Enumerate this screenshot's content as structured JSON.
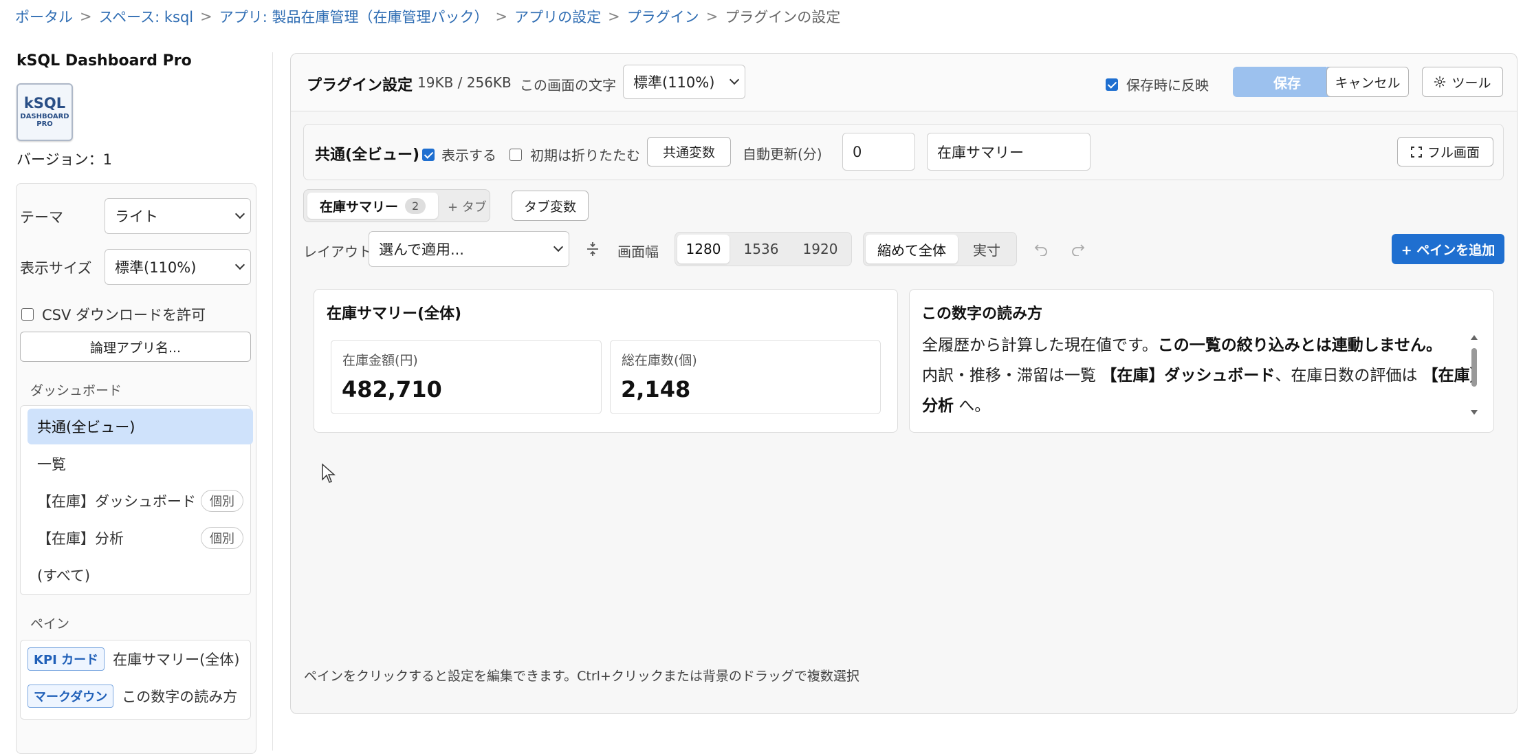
{
  "breadcrumb": {
    "portal": "ポータル",
    "space": "スペース: ksql",
    "app": "アプリ: 製品在庫管理（在庫管理パック）",
    "app_settings": "アプリの設定",
    "plugin": "プラグイン",
    "current": "プラグインの設定",
    "separator": ">"
  },
  "sidebar": {
    "app_name": "kSQL Dashboard Pro",
    "logo": {
      "line1": "kSQL",
      "line2": "DASHBOARD",
      "line3": "PRO"
    },
    "version": "バージョン：1",
    "theme_label": "テーマ",
    "theme_value": "ライト",
    "size_label": "表示サイズ",
    "size_value": "標準(110%)",
    "csv_label": "CSV ダウンロードを許可",
    "csv_checked": false,
    "logical_app_button": "論理アプリ名...",
    "dashboard_section": "ダッシュボード",
    "dashboards": [
      {
        "label": "共通(全ビュー)",
        "badge": "",
        "active": true
      },
      {
        "label": "一覧",
        "badge": "",
        "active": false
      },
      {
        "label": "【在庫】ダッシュボード",
        "badge": "個別",
        "active": false
      },
      {
        "label": "【在庫】分析",
        "badge": "個別",
        "active": false
      },
      {
        "label": "(すべて)",
        "badge": "",
        "active": false
      }
    ],
    "pane_section": "ペイン",
    "panes": [
      {
        "tag": "KPI カード",
        "label": "在庫サマリー(全体)"
      },
      {
        "tag": "マークダウン",
        "label": "この数字の読み方"
      }
    ]
  },
  "topbar": {
    "title": "プラグイン設定",
    "size_info": "19KB / 256KB",
    "font_label": "この画面の文字",
    "font_value": "標準(110%)",
    "apply_on_save_label": "保存時に反映",
    "apply_on_save_checked": true,
    "save_label": "保存",
    "cancel_label": "キャンセル",
    "tools_label": "ツール"
  },
  "common": {
    "title": "共通(全ビュー)",
    "show_label": "表示する",
    "show_checked": true,
    "collapse_label": "初期は折りたたむ",
    "collapse_checked": false,
    "vars_button": "共通変数",
    "refresh_label": "自動更新(分)",
    "refresh_value": "0",
    "name_value": "在庫サマリー",
    "fullscreen_label": "フル画面"
  },
  "tabs": {
    "active_label": "在庫サマリー",
    "active_count": "2",
    "add_tab": "+ タブ",
    "tab_vars_button": "タブ変数"
  },
  "layout": {
    "label": "レイアウト",
    "select_value": "選んで適用...",
    "width_label": "画面幅",
    "widths": [
      "1280",
      "1536",
      "1920"
    ],
    "active_width": "1280",
    "fit_label": "縮めて全体",
    "actual_label": "実寸",
    "add_pane": "+ ペインを追加"
  },
  "canvas": {
    "kpi_pane": {
      "title": "在庫サマリー(全体)",
      "cards": [
        {
          "label": "在庫金額(円)",
          "value": "482,710"
        },
        {
          "label": "総在庫数(個)",
          "value": "2,148"
        }
      ]
    },
    "md_pane": {
      "title": "この数字の読み方",
      "line1_plain": "全履歴から計算した現在値です。",
      "line1_bold": "この一覧の絞り込みとは連動しません。",
      "line2_plain1": "内訳・推移・滞留は一覧 ",
      "line2_bold1": "【在庫】ダッシュボード",
      "line2_plain2": "、在庫日数の評価は ",
      "line2_bold2a": "【在庫】",
      "line3_bold": "分析",
      "line3_plain": " へ。"
    }
  },
  "footer_hint": "ペインをクリックすると設定を編集できます。Ctrl+クリックまたは背景のドラッグで複数選択",
  "colors": {
    "primary": "#1f6fd0",
    "save_disabled": "#9cc1ee",
    "link": "#2f6db3",
    "active_item": "#cfe2fb"
  }
}
